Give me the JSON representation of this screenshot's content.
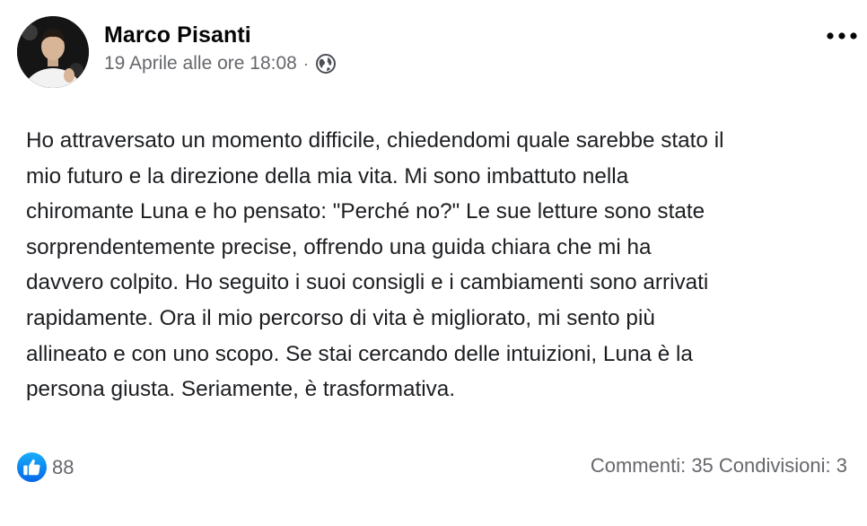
{
  "post": {
    "author": "Marco Pisanti",
    "timestamp": "19 Aprile alle ore 18:08",
    "separator": "·",
    "privacy_icon": "globe-icon",
    "more_icon": "more-options-icon",
    "text": "Ho attraversato un momento difficile, chiedendomi quale sarebbe stato il\nmio futuro e la direzione della mia vita. Mi sono imbattuto nella\nchiromante Luna e ho pensato: \"Perché no?\" Le sue letture sono state\nsorprendentemente precise, offrendo una guida chiara che mi ha\ndavvero colpito. Ho seguito i suoi consigli e i cambiamenti sono arrivati\nrapidamente. Ora il mio percorso di vita è migliorato, mi sento più\nallineato e con uno scopo. Se stai cercando delle intuizioni, Luna è la\npersona giusta. Seriamente, è trasformativa."
  },
  "reactions": {
    "icon": "like-icon",
    "count": "88"
  },
  "stats": {
    "comments": "Commenti: 35",
    "shares": "Condivisioni: 3"
  },
  "colors": {
    "primary_text": "#050505",
    "secondary_text": "#65676b",
    "like_blue": "#1877f2"
  }
}
